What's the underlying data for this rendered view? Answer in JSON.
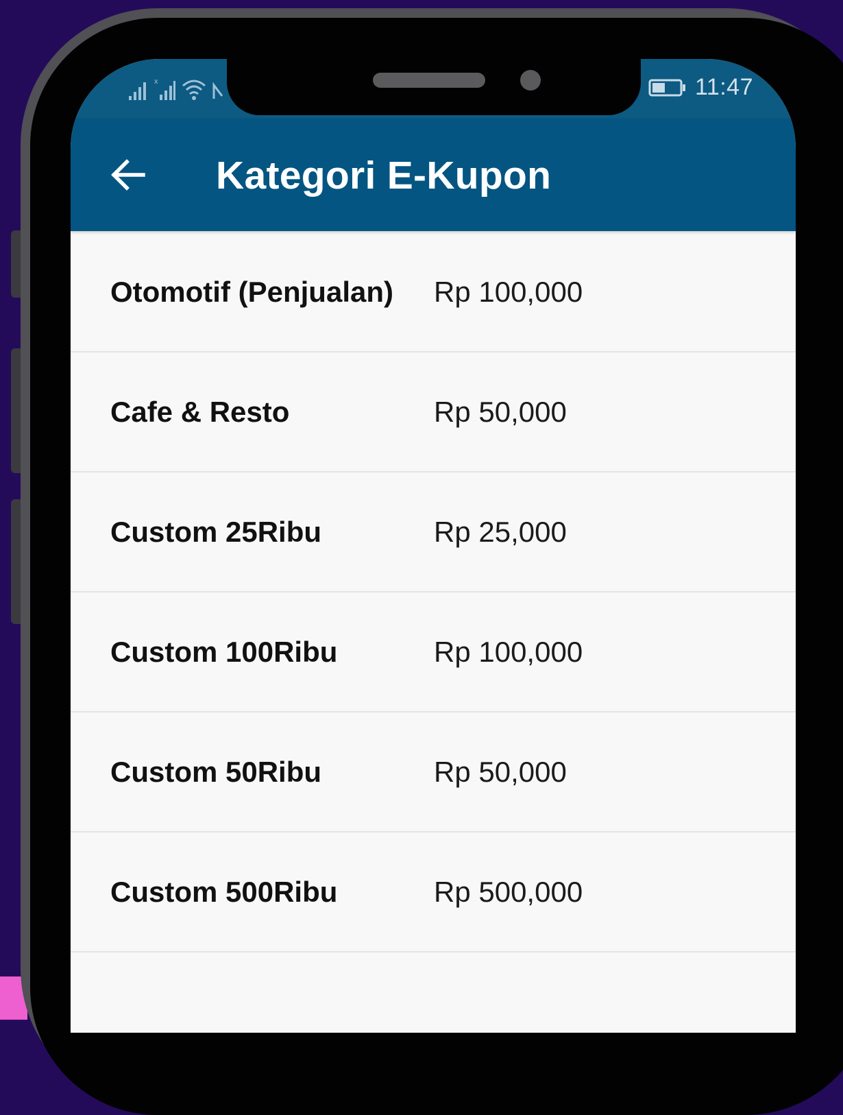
{
  "status_bar": {
    "time": "11:47",
    "icons": [
      "signal-icon",
      "signal-x-icon",
      "wifi-icon",
      "nfc-icon",
      "battery-icon"
    ]
  },
  "app_bar": {
    "title": "Kategori E-Kupon",
    "back_icon": "arrow-left-icon"
  },
  "items": [
    {
      "name": "Otomotif (Penjualan)",
      "price": "Rp 100,000"
    },
    {
      "name": "Cafe & Resto",
      "price": "Rp 50,000"
    },
    {
      "name": "Custom 25Ribu",
      "price": "Rp 25,000"
    },
    {
      "name": "Custom 100Ribu",
      "price": "Rp 100,000"
    },
    {
      "name": "Custom 50Ribu",
      "price": "Rp 50,000"
    },
    {
      "name": "Custom 500Ribu",
      "price": "Rp 500,000"
    }
  ],
  "colors": {
    "background": "#230b5a",
    "status_bar": "#0d5a83",
    "app_bar": "#045582",
    "list_background": "#f8f8f8",
    "accent_pink": "#ee5fd0"
  }
}
